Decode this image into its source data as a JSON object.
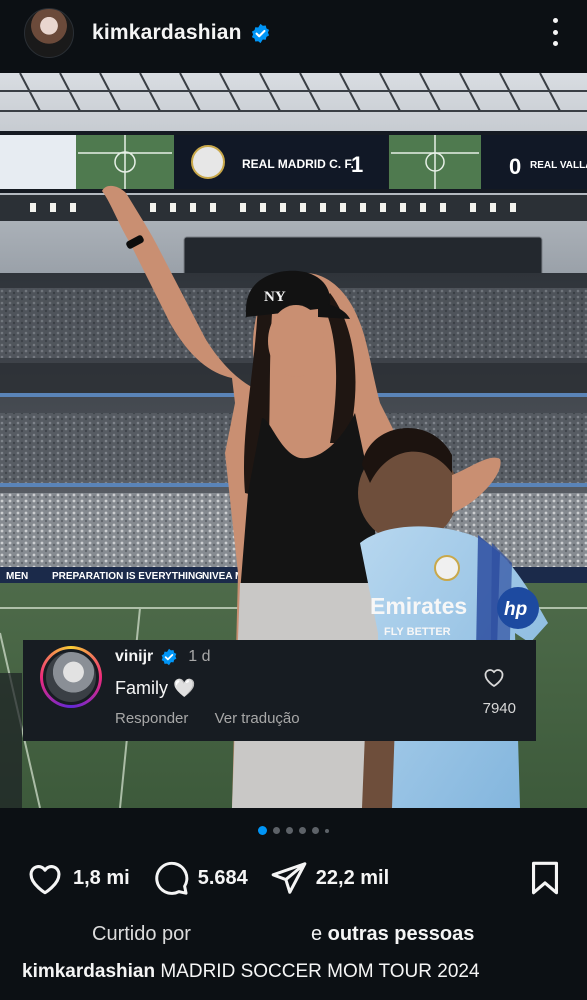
{
  "post": {
    "username": "kimkardashian",
    "verified": true,
    "more_icon": "more-vertical-icon"
  },
  "photo": {
    "scoreboard": {
      "home_team": "REAL MADRID C. F.",
      "home_score": "1",
      "away_score": "0",
      "away_team": "REAL VALLADO"
    },
    "ad_board_1": "PREPARATION IS EVERYTHING",
    "ad_board_2": "NIVEA MEN",
    "ad_board_prefix": "MEN",
    "cap_logo": "NY",
    "jersey_sponsor": "Emirates",
    "jersey_sponsor_line2": "FLY BETTER",
    "jersey_sleeve": "hp"
  },
  "comment": {
    "username": "vinijr",
    "verified": true,
    "time": "1 d",
    "text": "Family 🤍",
    "reply_label": "Responder",
    "translate_label": "Ver tradução",
    "like_count": "7940",
    "like_icon": "heart-outline-icon"
  },
  "carousel": {
    "count": 6,
    "active_index": 0
  },
  "actions": {
    "likes": "1,8 mi",
    "comments": "5.684",
    "shares": "22,2 mil",
    "icons": [
      "heart-icon",
      "comment-icon",
      "share-icon",
      "bookmark-icon"
    ]
  },
  "liked_by": {
    "prefix": "Curtido por",
    "suffix_plain": "e",
    "suffix_bold": "outras pessoas"
  },
  "caption": {
    "username": "kimkardashian",
    "text": "MADRID SOCCER MOM TOUR 2024"
  },
  "colors": {
    "background": "#0c1014",
    "accent": "#0095f6",
    "verified": "#0095f6"
  }
}
